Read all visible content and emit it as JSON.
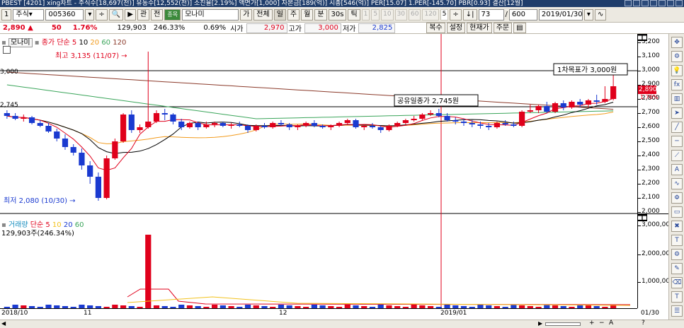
{
  "titlebar": {
    "text": "PBEST   [4201] xing차트 - 주식수[18,697(천)] 유동수[12,552(천)] 소진율[2.19%] 액면가[1,000] 자본금[189(억)] 시총[546(억)] PER[15.07] 1.PER[-145.70] PBR[0.93] 결산[12월]"
  },
  "toolbar": {
    "index_label": "1",
    "market_label": "주식",
    "code": "005360",
    "btn_kan": "관",
    "btn_jeon": "전",
    "btn_jeon_green": "종목",
    "stock_name": "모나미",
    "btn_ga": "가",
    "btn_all": "전체",
    "periods": [
      "일",
      "주",
      "월",
      "분",
      "30s",
      "틱"
    ],
    "period_nums": [
      "1",
      "5",
      "10",
      "30",
      "60",
      "120",
      "5"
    ],
    "count_a": "73",
    "count_b": "600",
    "date": "2019/01/30"
  },
  "quote": {
    "price": "2,890",
    "arrow": "▲",
    "change": "50",
    "change_pct": "1.76%",
    "volume": "129,903",
    "vol_ratio": "246.33%",
    "turnover": "0.69%",
    "open_label": "시가",
    "open": "2,970",
    "high_label": "고가",
    "high": "3,000",
    "low_label": "저가",
    "low": "2,825",
    "btns": [
      "복수",
      "설정",
      "현재가",
      "주문"
    ]
  },
  "main_legend": {
    "name": "모나미",
    "ma_label": "종가 단순",
    "ma": [
      "5",
      "10",
      "20",
      "60",
      "120"
    ]
  },
  "vol_legend": {
    "name": "거래량",
    "ma_label": "단순",
    "ma": [
      "5",
      "10",
      "20",
      "60"
    ],
    "value": "129,903주(246.34%)"
  },
  "annotations": {
    "high": "최고 3,135 (11/07)",
    "low": "최저 2,080 (10/30)",
    "target": "1차목표가 3,000원",
    "public": "공유일종가 2,745원",
    "line_3000": "3,000",
    "line_2745": "2,745",
    "current_price_tag": "2,890",
    "current_pct_tag": "1.76%"
  },
  "y_axis_main": [
    "3,200",
    "3,100",
    "3,000",
    "2,900",
    "2,800",
    "2,700",
    "2,600",
    "2,500",
    "2,400",
    "2,300",
    "2,200",
    "2,100",
    "2,000"
  ],
  "y_axis_vol": [
    "3,000,000",
    "2,000,000",
    "1,000,000"
  ],
  "x_axis": [
    "2018/10",
    "11",
    "12",
    "2019/01",
    "01/30"
  ],
  "colors": {
    "up": "#e0001b",
    "down": "#1a3ad0",
    "ma5": "#e0001b",
    "ma10": "#000000",
    "ma20": "#f29b1d",
    "ma60": "#3aa55a",
    "ma120": "#8b3a2a"
  },
  "chart_data": {
    "type": "candlestick",
    "ylim": [
      2000,
      3200
    ],
    "candles": [
      [
        2700,
        2720,
        2660,
        2680
      ],
      [
        2680,
        2700,
        2650,
        2660
      ],
      [
        2660,
        2690,
        2640,
        2670
      ],
      [
        2670,
        2680,
        2620,
        2630
      ],
      [
        2630,
        2650,
        2600,
        2610
      ],
      [
        2610,
        2630,
        2560,
        2570
      ],
      [
        2570,
        2590,
        2500,
        2520
      ],
      [
        2520,
        2550,
        2440,
        2460
      ],
      [
        2460,
        2480,
        2400,
        2420
      ],
      [
        2420,
        2450,
        2300,
        2330
      ],
      [
        2330,
        2360,
        2200,
        2250
      ],
      [
        2250,
        2280,
        2080,
        2100
      ],
      [
        2100,
        2400,
        2090,
        2380
      ],
      [
        2380,
        2520,
        2370,
        2500
      ],
      [
        2500,
        2700,
        2490,
        2690
      ],
      [
        2690,
        2720,
        2560,
        2580
      ],
      [
        2580,
        2620,
        2560,
        2600
      ],
      [
        2600,
        3135,
        2590,
        2640
      ],
      [
        2640,
        2720,
        2630,
        2700
      ],
      [
        2700,
        2730,
        2650,
        2690
      ],
      [
        2690,
        2700,
        2620,
        2640
      ],
      [
        2640,
        2660,
        2580,
        2600
      ],
      [
        2600,
        2640,
        2590,
        2630
      ],
      [
        2630,
        2640,
        2580,
        2600
      ],
      [
        2600,
        2640,
        2590,
        2620
      ],
      [
        2620,
        2640,
        2600,
        2630
      ],
      [
        2630,
        2640,
        2600,
        2610
      ],
      [
        2610,
        2630,
        2590,
        2620
      ],
      [
        2620,
        2640,
        2600,
        2610
      ],
      [
        2610,
        2620,
        2560,
        2580
      ],
      [
        2580,
        2620,
        2570,
        2610
      ],
      [
        2610,
        2630,
        2590,
        2600
      ],
      [
        2600,
        2640,
        2590,
        2630
      ],
      [
        2630,
        2650,
        2610,
        2620
      ],
      [
        2620,
        2630,
        2580,
        2600
      ],
      [
        2600,
        2620,
        2580,
        2610
      ],
      [
        2610,
        2640,
        2600,
        2630
      ],
      [
        2630,
        2650,
        2600,
        2610
      ],
      [
        2610,
        2620,
        2590,
        2600
      ],
      [
        2600,
        2620,
        2580,
        2610
      ],
      [
        2610,
        2640,
        2600,
        2630
      ],
      [
        2630,
        2660,
        2620,
        2650
      ],
      [
        2650,
        2660,
        2590,
        2600
      ],
      [
        2600,
        2620,
        2580,
        2610
      ],
      [
        2610,
        2630,
        2590,
        2600
      ],
      [
        2600,
        2610,
        2560,
        2580
      ],
      [
        2580,
        2620,
        2570,
        2610
      ],
      [
        2610,
        2640,
        2600,
        2630
      ],
      [
        2630,
        2660,
        2620,
        2650
      ],
      [
        2650,
        2680,
        2640,
        2660
      ],
      [
        2660,
        2700,
        2650,
        2690
      ],
      [
        2690,
        2720,
        2680,
        2700
      ],
      [
        2700,
        2730,
        2670,
        2680
      ],
      [
        2680,
        2700,
        2640,
        2650
      ],
      [
        2650,
        2670,
        2620,
        2640
      ],
      [
        2640,
        2660,
        2610,
        2630
      ],
      [
        2630,
        2650,
        2600,
        2620
      ],
      [
        2620,
        2640,
        2590,
        2610
      ],
      [
        2610,
        2630,
        2580,
        2600
      ],
      [
        2600,
        2640,
        2590,
        2630
      ],
      [
        2630,
        2650,
        2610,
        2620
      ],
      [
        2620,
        2640,
        2600,
        2610
      ],
      [
        2610,
        2720,
        2600,
        2710
      ],
      [
        2710,
        2760,
        2700,
        2720
      ],
      [
        2720,
        2760,
        2700,
        2750
      ],
      [
        2750,
        2780,
        2700,
        2710
      ],
      [
        2710,
        2780,
        2700,
        2770
      ],
      [
        2770,
        2790,
        2720,
        2740
      ],
      [
        2740,
        2790,
        2730,
        2780
      ],
      [
        2780,
        2800,
        2740,
        2760
      ],
      [
        2760,
        2800,
        2740,
        2790
      ],
      [
        2790,
        2830,
        2760,
        2780
      ],
      [
        2780,
        2890,
        2770,
        2800
      ],
      [
        2800,
        2980,
        2790,
        2890
      ]
    ],
    "volume_peak_index": 17
  }
}
